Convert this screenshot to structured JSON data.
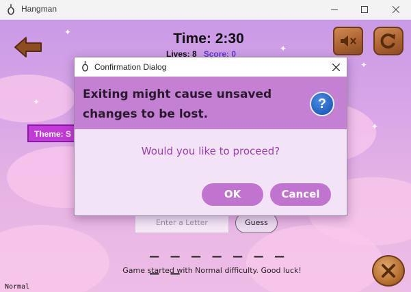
{
  "window": {
    "title": "Hangman",
    "icon": "hangman-noose-icon",
    "controls": [
      "minimize-icon",
      "maximize-icon",
      "close-icon"
    ]
  },
  "game": {
    "timer": "Time: 2:30",
    "lives": "Lives: 8",
    "score": "Score: 0",
    "theme_label": "Theme: S",
    "input_placeholder": "Enter a Letter",
    "guess_label": "Guess",
    "word_blanks": "_ _ _ _ _ _ _ _ _",
    "status_message": "Game started with Normal difficulty. Good luck!",
    "difficulty": "Normal",
    "icons": [
      "back-arrow-icon",
      "mute-icon",
      "restart-icon",
      "hint-icon"
    ]
  },
  "dialog": {
    "title": "Confirmation Dialog",
    "heading": "Exiting might cause unsaved changes to be lost.",
    "message": "Would you like to proceed?",
    "ok_label": "OK",
    "cancel_label": "Cancel",
    "icon": "question-icon"
  },
  "colors": {
    "dialog_header": "#c481d4",
    "dialog_body": "#f3e3f6",
    "button": "#c174cf",
    "message_text": "#9a3fb0",
    "theme_tag": "#c23ad8",
    "wood": "#a8612e"
  }
}
